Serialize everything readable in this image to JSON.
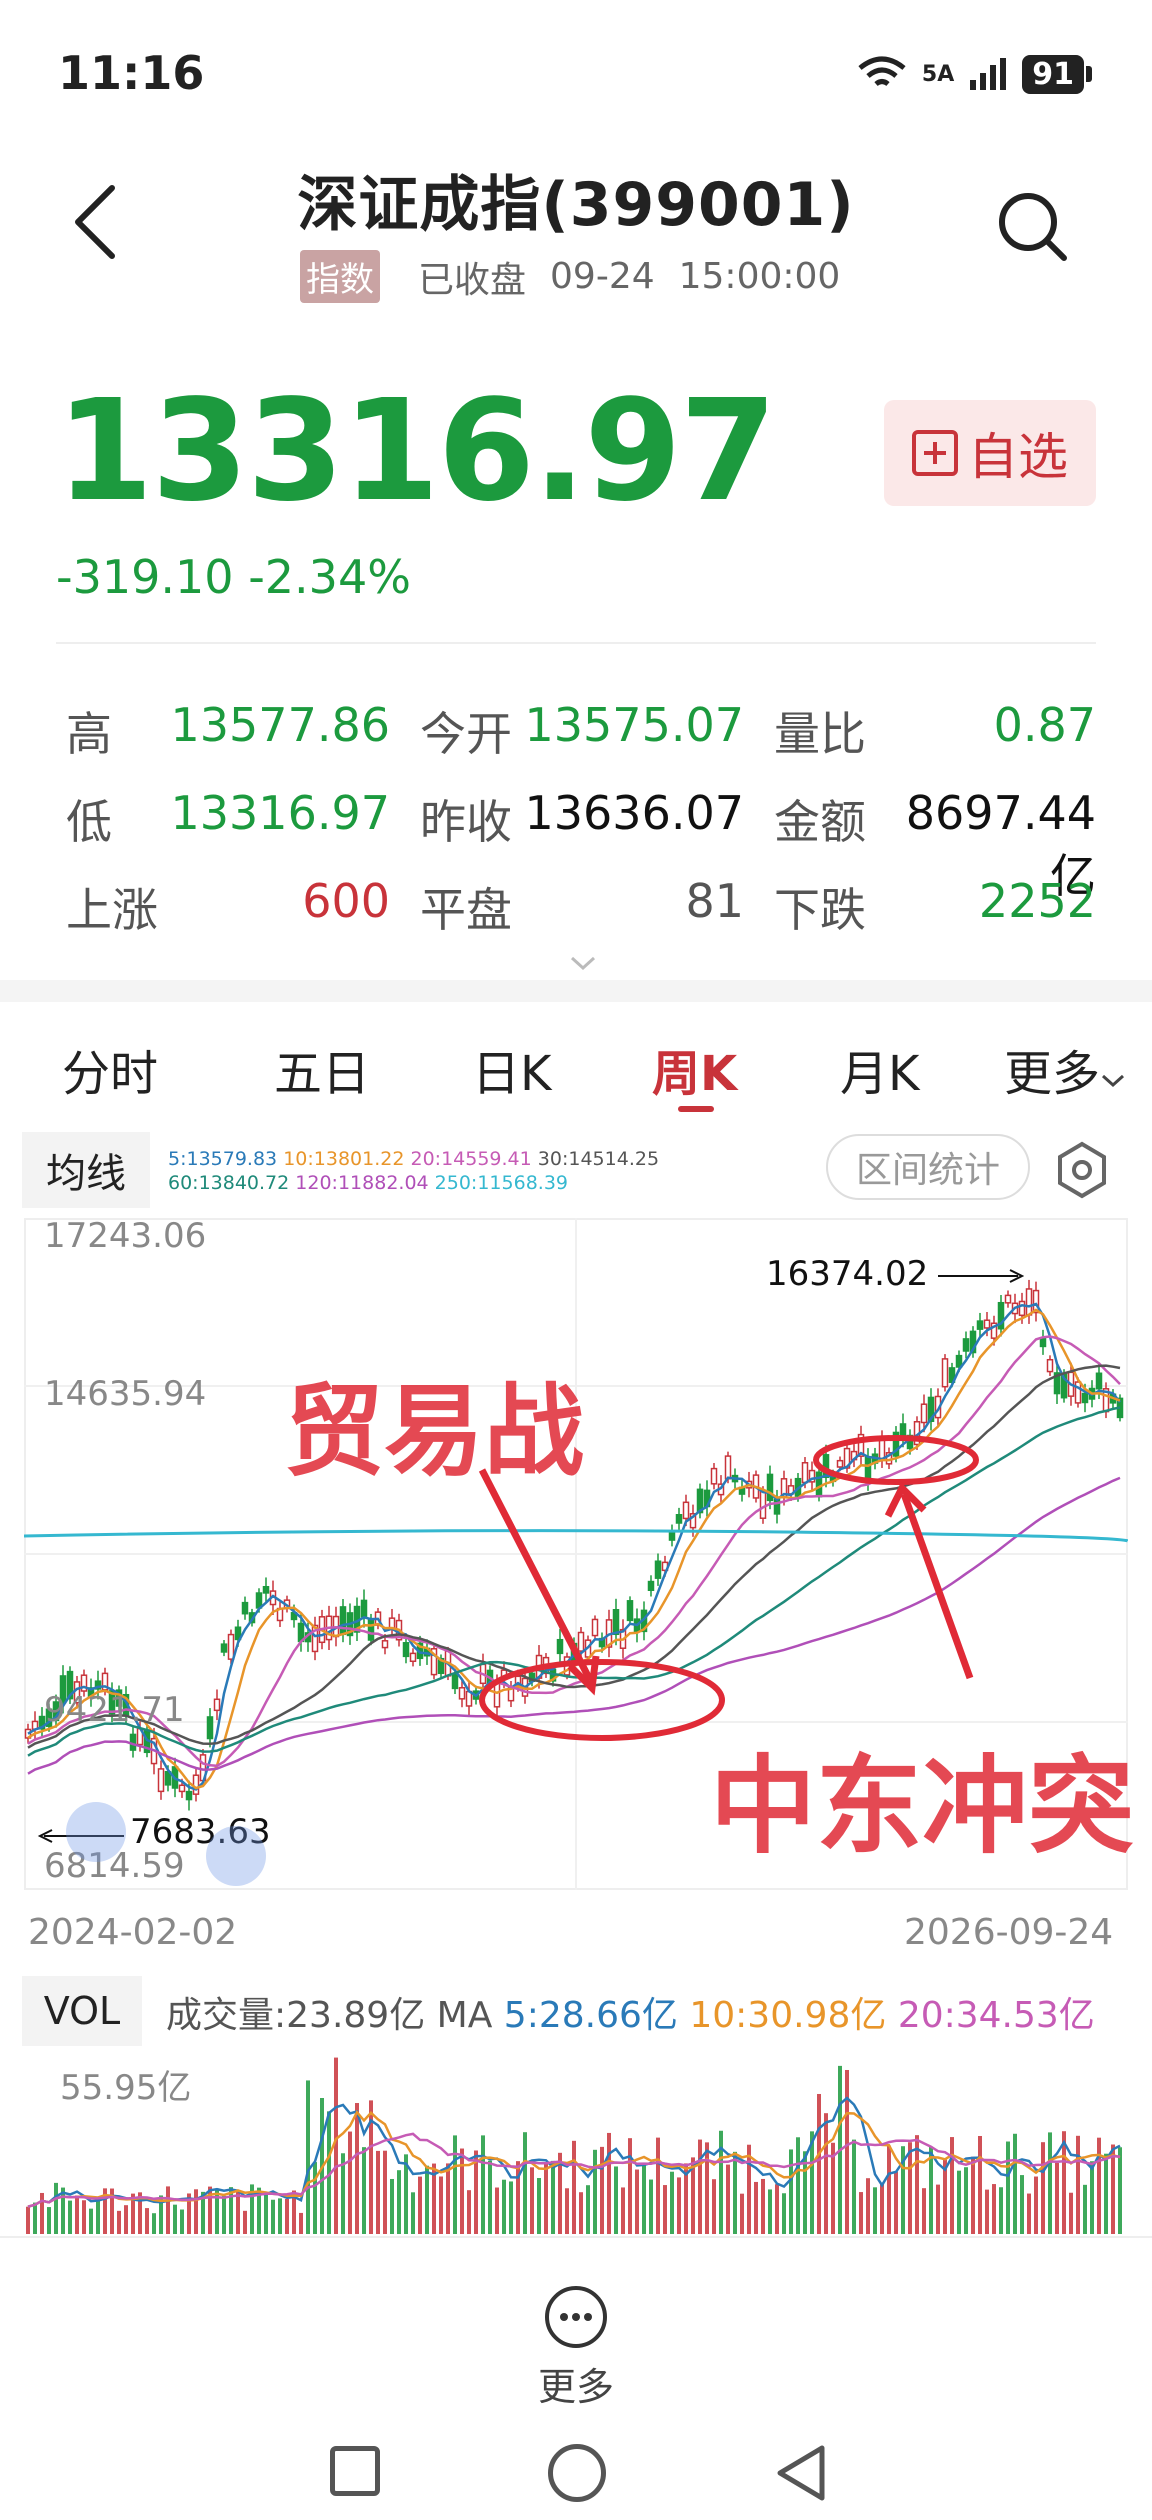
{
  "status_bar": {
    "time": "11:16",
    "network": "5A",
    "battery": "91"
  },
  "header": {
    "title": "深证成指(399001)",
    "badge": "指数",
    "market_status": "已收盘",
    "date": "09-24",
    "time": "15:00:00"
  },
  "quote": {
    "price": "13316.97",
    "change": "-319.10",
    "change_pct": "-2.34%",
    "watchlist_label": "自选"
  },
  "stats": {
    "high_label": "高",
    "high": "13577.86",
    "open_label": "今开",
    "open": "13575.07",
    "vol_ratio_label": "量比",
    "vol_ratio": "0.87",
    "low_label": "低",
    "low": "13316.97",
    "prev_close_label": "昨收",
    "prev_close": "13636.07",
    "amount_label": "金额",
    "amount": "8697.44亿",
    "up_label": "上涨",
    "up": "600",
    "flat_label": "平盘",
    "flat": "81",
    "down_label": "下跌",
    "down": "2252"
  },
  "tabs": [
    "分时",
    "五日",
    "日K",
    "周K",
    "月K",
    "更多"
  ],
  "ma_panel": {
    "label": "均线",
    "ma5": "5:13579.83",
    "ma10": "10:13801.22",
    "ma20": "20:14559.41",
    "ma30": "30:14514.25",
    "ma60": "60:13840.72",
    "ma120": "120:11882.04",
    "ma250": "250:11568.39",
    "range_button": "区间统计"
  },
  "colors": {
    "green": "#1c9a3e",
    "red": "#c8333a",
    "ma5": "#2a7ab8",
    "ma10": "#e8952a",
    "ma20": "#c65bb5",
    "ma30": "#555555",
    "ma60": "#1f8a7a",
    "ma120": "#b04fb8",
    "ma250": "#35b8d0"
  },
  "chart_data": {
    "type": "candlestick",
    "y_ticks": [
      "17243.06",
      "14635.94",
      "9421.71",
      "6814.59"
    ],
    "x_start": "2024-02-02",
    "x_end": "2026-09-24",
    "peak_label": "16374.02",
    "low_label": "7683.63",
    "annotations": [
      "贸易战",
      "中东冲突"
    ]
  },
  "volume": {
    "label": "VOL",
    "total": "成交量:23.89亿",
    "ma_label": "MA",
    "ma5": "5:28.66亿",
    "ma10": "10:30.98亿",
    "ma20": "20:34.53亿",
    "max": "55.95亿"
  },
  "bottom": {
    "more_label": "更多"
  }
}
